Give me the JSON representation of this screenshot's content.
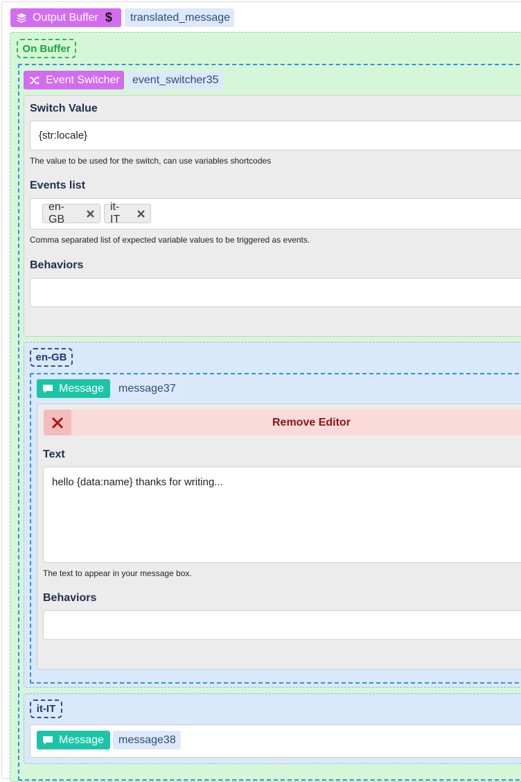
{
  "output_buffer": {
    "tag_label": "Output Buffer",
    "name": "translated_message",
    "on_buffer_label": "On Buffer"
  },
  "event_switcher": {
    "tag_label": "Event Switcher",
    "name": "event_switcher35",
    "switch_value_label": "Switch Value",
    "switch_value": "{str:locale}",
    "switch_value_help": "The value to be used for the switch, can use variables shortcodes",
    "events_list_label": "Events list",
    "events": [
      "en-GB",
      "it-IT"
    ],
    "events_list_help": "Comma separated list of expected variable values to be triggered as events.",
    "behaviors_label": "Behaviors"
  },
  "event_en": {
    "label": "en-GB",
    "message": {
      "tag_label": "Message",
      "name": "message37",
      "remove_label": "Remove Editor",
      "text_label": "Text",
      "text_value": "hello {data:name} thanks for writing...",
      "text_help": "The text to appear in your message box.",
      "behaviors_label": "Behaviors"
    }
  },
  "event_it": {
    "label": "it-IT",
    "message": {
      "tag_label": "Message",
      "name": "message38"
    }
  },
  "colors": {
    "purple_tag": "#d36cf0",
    "teal_tag": "#1cc4a7",
    "green_container": "#d5f7d8",
    "blue_container": "#dae8fb",
    "remove_bar": "#fbdada"
  },
  "icons": {
    "output_buffer": "layers-icon",
    "output_buffer_suffix": "dollar-icon",
    "event_switcher": "shuffle-icon",
    "message": "comment-icon",
    "chip_remove": "close-icon",
    "remove_editor": "close-icon"
  }
}
